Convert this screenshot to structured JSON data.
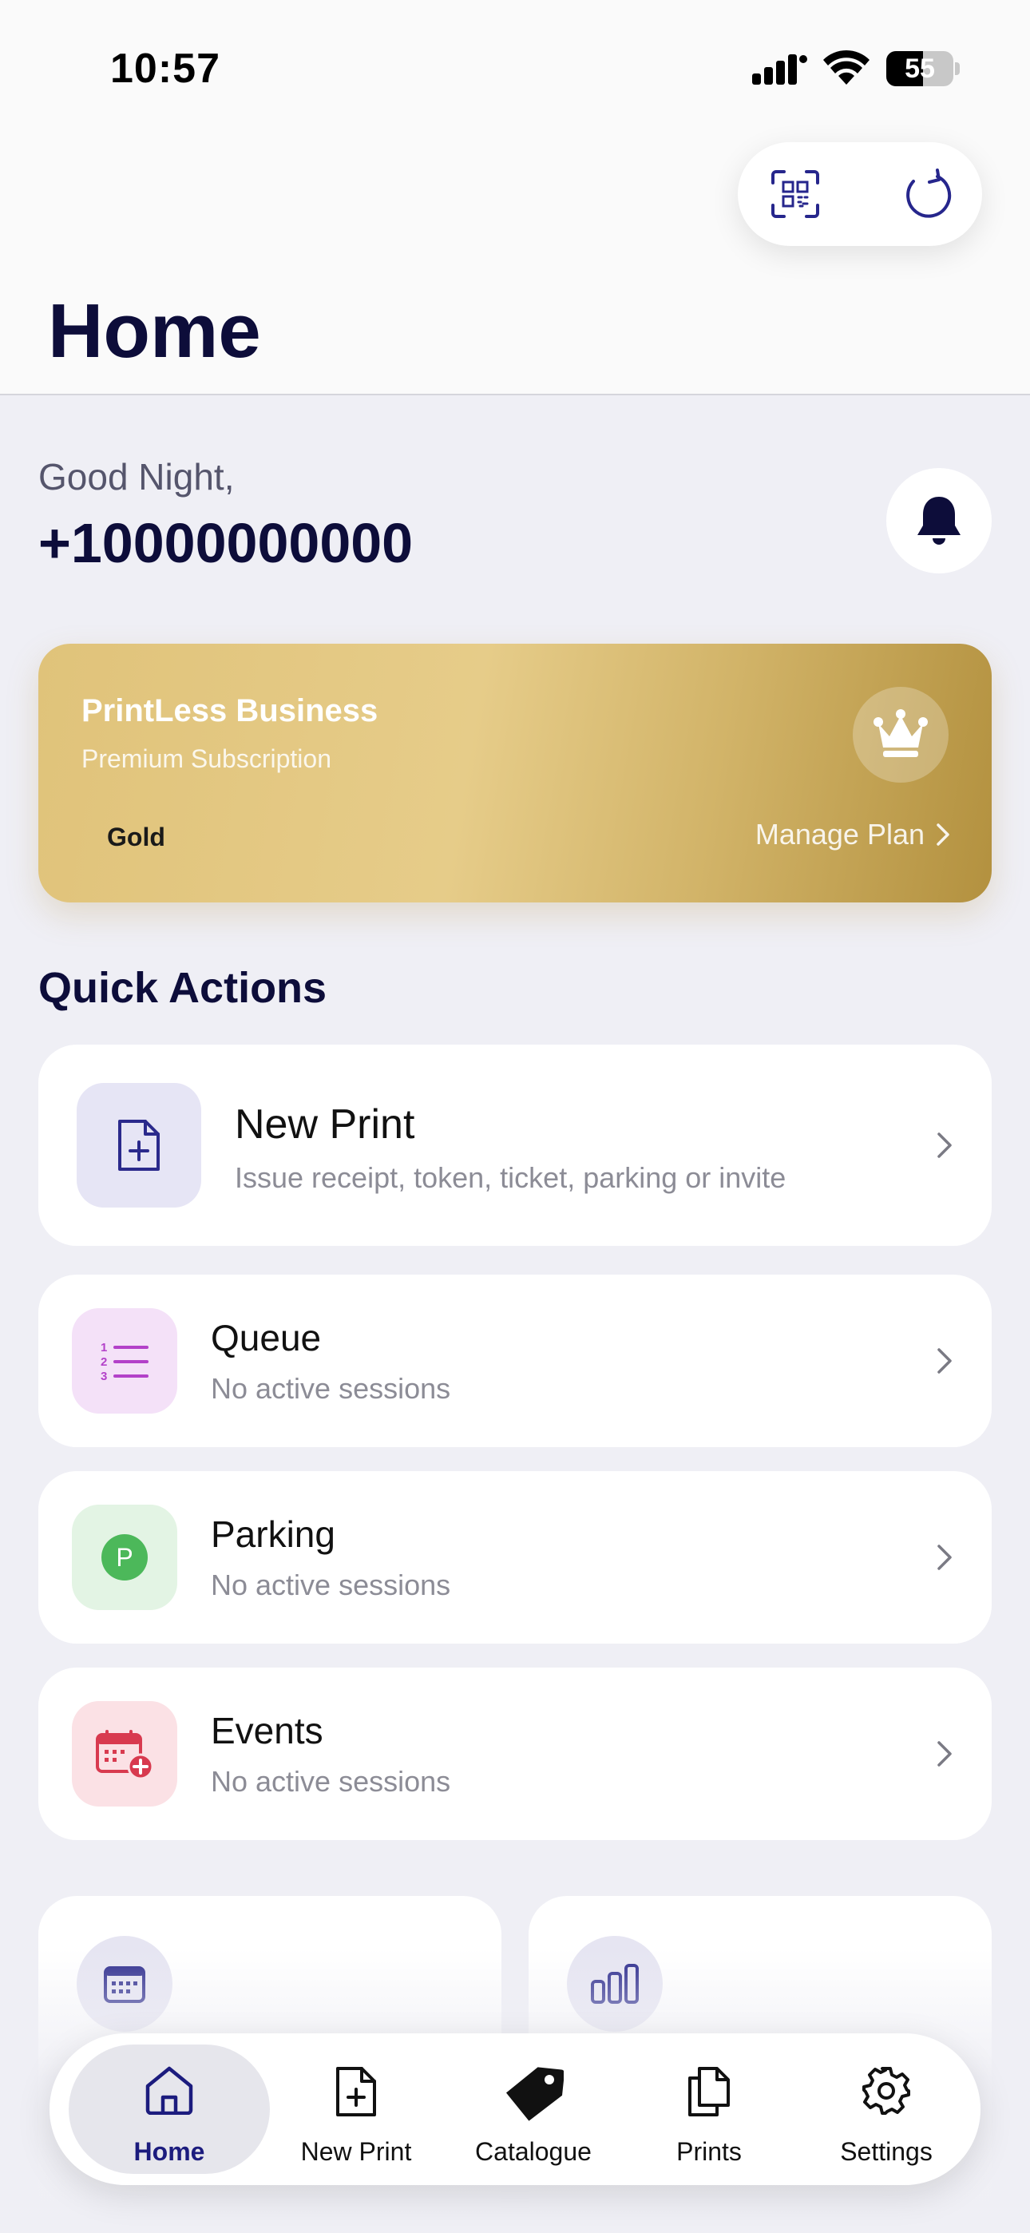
{
  "status": {
    "time": "10:57",
    "battery": "55"
  },
  "header": {
    "title": "Home",
    "qr_icon": "qr-scan-icon",
    "refresh_icon": "refresh-icon"
  },
  "user": {
    "greeting": "Good Night,",
    "phone": "+10000000000"
  },
  "plan": {
    "name": "PrintLess Business",
    "subtitle": "Premium Subscription",
    "tier": "Gold",
    "manage_label": "Manage Plan",
    "accent": "#d9bb6e"
  },
  "quick_actions": {
    "title": "Quick Actions",
    "items": [
      {
        "title": "New Print",
        "subtitle": "Issue receipt, token, ticket, parking or invite",
        "icon": "file-plus-icon",
        "color": "#2b2a8c"
      },
      {
        "title": "Queue",
        "subtitle": "No active sessions",
        "icon": "numbered-list-icon",
        "color": "#b341c9"
      },
      {
        "title": "Parking",
        "subtitle": "No active sessions",
        "icon": "parking-icon",
        "color": "#4cb85a"
      },
      {
        "title": "Events",
        "subtitle": "No active sessions",
        "icon": "calendar-plus-icon",
        "color": "#d83a4f"
      }
    ]
  },
  "tabs": [
    {
      "label": "Home",
      "icon": "home-icon",
      "active": true
    },
    {
      "label": "New Print",
      "icon": "file-plus-icon",
      "active": false
    },
    {
      "label": "Catalogue",
      "icon": "tag-icon",
      "active": false
    },
    {
      "label": "Prints",
      "icon": "documents-icon",
      "active": false
    },
    {
      "label": "Settings",
      "icon": "gear-icon",
      "active": false
    }
  ]
}
